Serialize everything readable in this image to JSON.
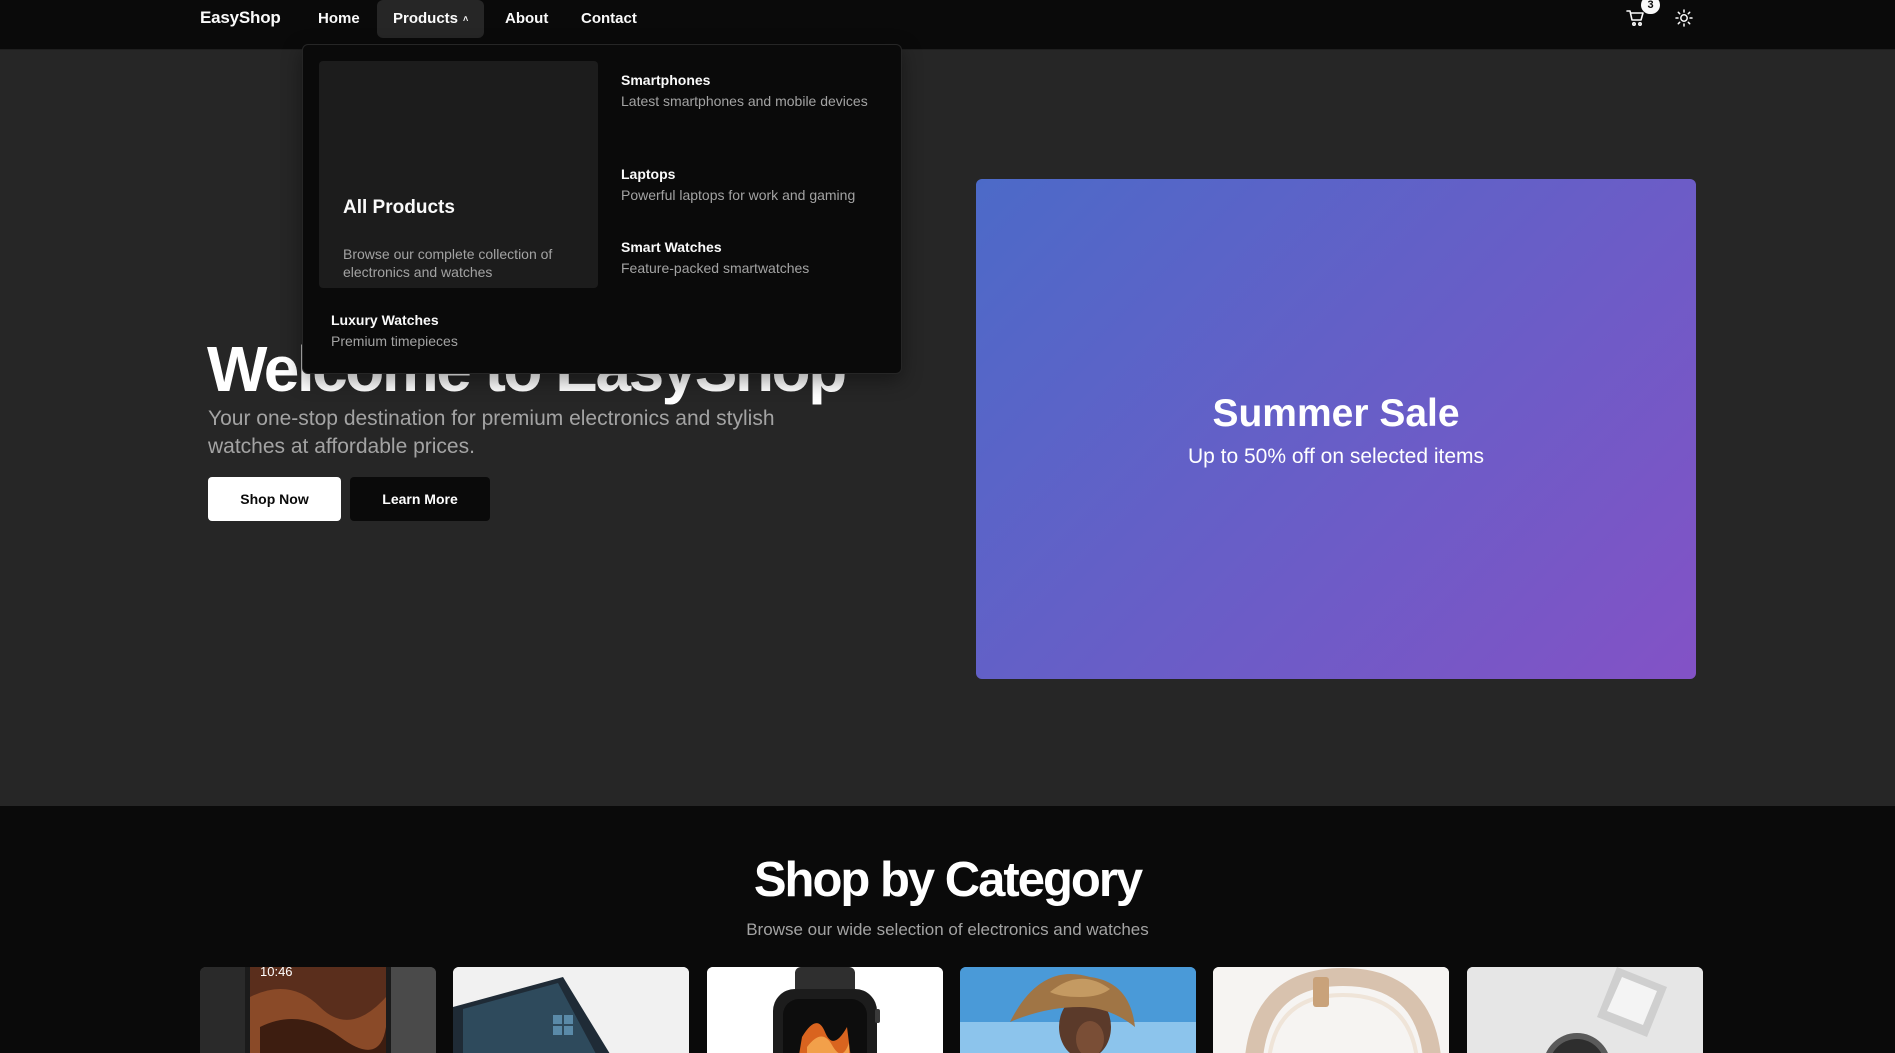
{
  "navbar": {
    "brand": "EasyShop",
    "links": [
      {
        "label": "Home"
      },
      {
        "label": "Products"
      },
      {
        "label": "About"
      },
      {
        "label": "Contact"
      }
    ],
    "cart_count": "3"
  },
  "hero": {
    "title": "Welcome to EasyShop",
    "subtitle": "Your one-stop destination for premium electronics and stylish watches at affordable prices.",
    "primary_button": "Shop Now",
    "secondary_button": "Learn More"
  },
  "promo": {
    "title": "Summer Sale",
    "subtitle": "Up to 50% off on selected items"
  },
  "products_menu": {
    "featured": {
      "title": "All Products",
      "description": "Browse our complete collection of electronics and watches"
    },
    "items": [
      {
        "title": "Smartphones",
        "description": "Latest smartphones and mobile devices"
      },
      {
        "title": "Laptops",
        "description": "Powerful laptops for work and gaming"
      },
      {
        "title": "Smart Watches",
        "description": "Feature-packed smartwatches"
      },
      {
        "title": "Luxury Watches",
        "description": "Premium timepieces"
      }
    ]
  },
  "category_section": {
    "title": "Shop by Category",
    "subtitle": "Browse our wide selection of electronics and watches",
    "phone_time": "10:46"
  },
  "colors": {
    "background": "#262626",
    "navbar": "#0a0a0a",
    "promo_gradient_start": "#4c6ac8",
    "promo_gradient_end": "#8352c6"
  }
}
